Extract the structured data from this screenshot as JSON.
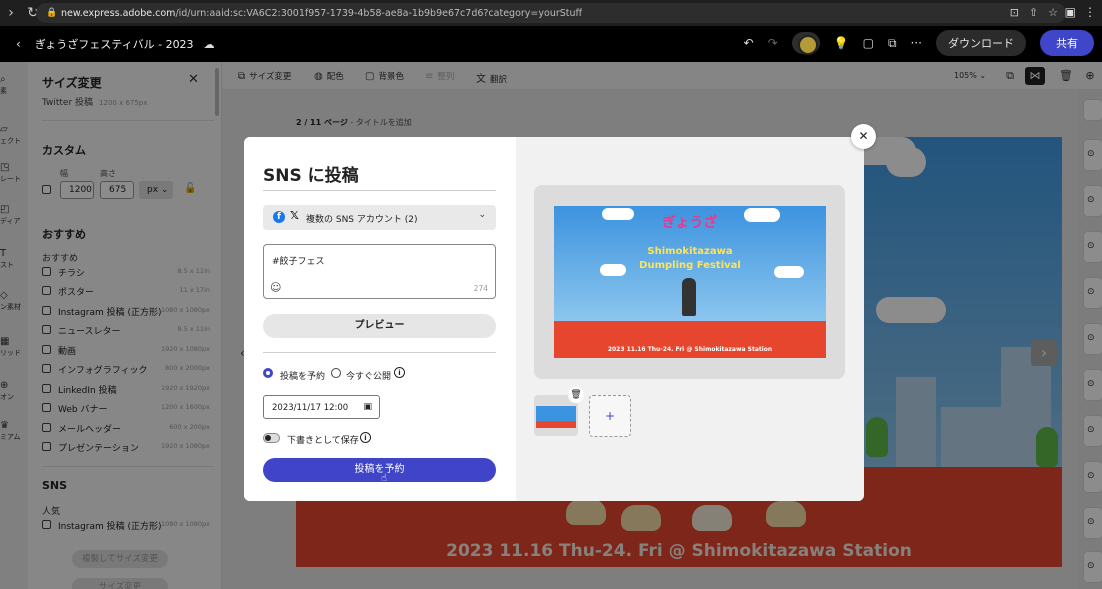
{
  "browser": {
    "url_host": "new.express.adobe.com",
    "url_path": "/id/urn:aaid:sc:VA6C2:3001f957-1739-4b58-ae8a-1b9b9e67c7d6?category=yourStuff"
  },
  "header": {
    "doc_title": "ぎょうざフェスティバル - 2023",
    "download_label": "ダウンロード",
    "share_label": "共有"
  },
  "left_rail": {
    "items": [
      "素",
      "ェクト",
      "レート",
      "ディア",
      "スト",
      "ン素材",
      "リッド",
      "オン",
      "ミアム"
    ]
  },
  "resize_panel": {
    "title": "サイズ変更",
    "current_format": "Twitter 投稿",
    "current_size": "1200 x 675px",
    "custom_heading": "カスタム",
    "width_label": "幅",
    "height_label": "高さ",
    "width_value": "1200",
    "height_value": "675",
    "unit": "px",
    "recommended_heading": "おすすめ",
    "recommended_sub": "おすすめ",
    "recommended": [
      {
        "name": "チラシ",
        "size": "8.5 x 11in"
      },
      {
        "name": "ポスター",
        "size": "11 x 17in"
      },
      {
        "name": "Instagram 投稿 (正方形)",
        "size": "1080 x 1080px"
      },
      {
        "name": "ニュースレター",
        "size": "8.5 x 11in"
      },
      {
        "name": "動画",
        "size": "1920 x 1080px"
      },
      {
        "name": "インフォグラフィック",
        "size": "800 x 2000px"
      },
      {
        "name": "LinkedIn 投稿",
        "size": "1920 x 1920px"
      },
      {
        "name": "Web バナー",
        "size": "1200 x 1600px"
      },
      {
        "name": "メールヘッダー",
        "size": "600 x 200px"
      },
      {
        "name": "プレゼンテーション",
        "size": "1920 x 1080px"
      }
    ],
    "sns_heading": "SNS",
    "popular_label": "人気",
    "sns": [
      {
        "name": "Instagram 投稿 (正方形)",
        "size": "1080 x 1080px"
      }
    ],
    "copy_resize_btn": "複製してサイズ変更",
    "resize_btn": "サイズ変更"
  },
  "toolbar": {
    "resize": "サイズ変更",
    "color": "配色",
    "background": "背景色",
    "arrange": "整列",
    "translate": "翻訳",
    "zoom": "105%"
  },
  "canvas": {
    "page_indicator": "2 / 11 ページ",
    "add_title": " - タイトルを追加",
    "design_caption": "2023 11.16 Thu-24. Fri @ Shimokitazawa Station"
  },
  "modal": {
    "title": "SNS に投稿",
    "accounts_label": "複数の SNS アカウント (2)",
    "post_text": "#餃子フェス",
    "char_count": "274",
    "preview_btn": "プレビュー",
    "schedule_label": "投稿を予約",
    "publish_now_label": "今すぐ公開",
    "date_value": "2023/11/17 12:00",
    "draft_label": "下書きとして保存",
    "submit_btn": "投稿を予約",
    "preview_logo": "ぎょうざ",
    "preview_line1": "Shimokitazawa",
    "preview_line2": "Dumpling Festival",
    "preview_caption": "2023 11.16 Thu-24. Fri @ Shimokitazawa Station",
    "add_symbol": "+"
  },
  "colors": {
    "accent": "#4046ca",
    "facebook": "#1877f2",
    "design_ground": "#e6462e",
    "design_sky": "#3f9ae4"
  },
  "icons": [
    "lock-icon",
    "back-icon",
    "cloud-icon",
    "undo-icon",
    "redo-icon",
    "lightbulb-icon",
    "comment-icon",
    "more-icon",
    "close-icon",
    "facebook-icon",
    "x-icon",
    "chevron-down-icon",
    "emoji-icon",
    "info-icon",
    "calendar-icon",
    "trash-icon",
    "plus-icon"
  ]
}
